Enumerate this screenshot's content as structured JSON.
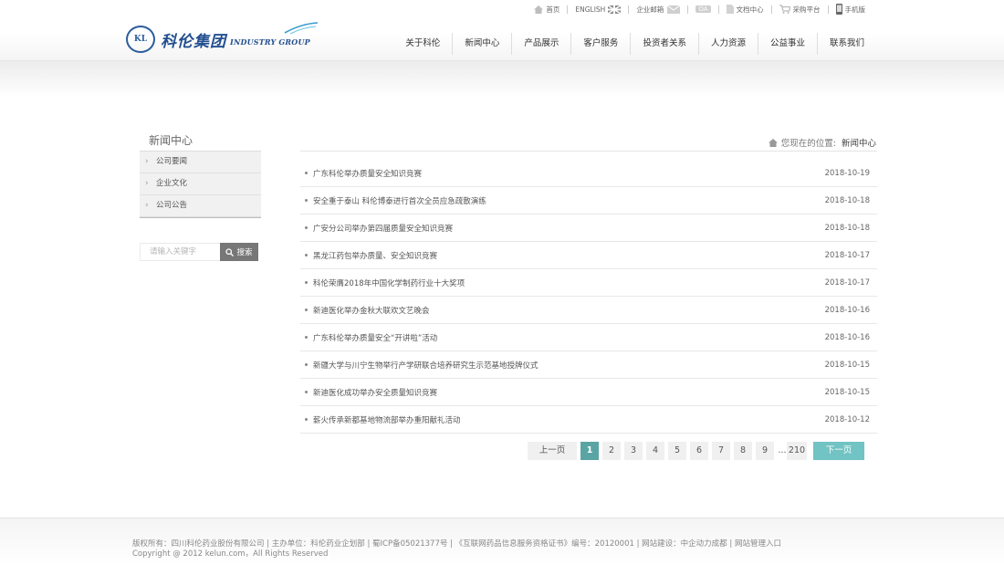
{
  "util_bar": {
    "home": "首页",
    "english": "ENGLISH",
    "mail": "企业邮箱",
    "oa": "OA",
    "docs": "文档中心",
    "purchase": "采购平台",
    "mobile": "手机版"
  },
  "logo": {
    "cn": "科伦集团",
    "en": "INDUSTRY GROUP",
    "emblem": "KL"
  },
  "nav": [
    "关于科伦",
    "新闻中心",
    "产品展示",
    "客户服务",
    "投资者关系",
    "人力资源",
    "公益事业",
    "联系我们"
  ],
  "sidebar": {
    "title": "新闻中心",
    "items": [
      "公司要闻",
      "企业文化",
      "公司公告"
    ]
  },
  "search": {
    "placeholder": "请输入关键字",
    "button": "搜索"
  },
  "breadcrumb": {
    "prefix": "您现在的位置:",
    "current": "新闻中心"
  },
  "news": [
    {
      "title": "广东科伦举办质量安全知识竞赛",
      "date": "2018-10-19"
    },
    {
      "title": "安全重于泰山 科伦博泰进行首次全员应急疏散演练",
      "date": "2018-10-18"
    },
    {
      "title": "广安分公司举办第四届质量安全知识竞赛",
      "date": "2018-10-18"
    },
    {
      "title": "黑龙江药包举办质量、安全知识竞赛",
      "date": "2018-10-17"
    },
    {
      "title": "科伦荣膺2018年中国化学制药行业十大奖项",
      "date": "2018-10-17"
    },
    {
      "title": "新迪医化举办金秋大联欢文艺晚会",
      "date": "2018-10-16"
    },
    {
      "title": "广东科伦举办质量安全“开讲啦”活动",
      "date": "2018-10-16"
    },
    {
      "title": "新疆大学与川宁生物举行产学研联合培养研究生示范基地授牌仪式",
      "date": "2018-10-15"
    },
    {
      "title": "新迪医化成功举办安全质量知识竞赛",
      "date": "2018-10-15"
    },
    {
      "title": "薪火传承新都基地物流部举办重阳献礼活动",
      "date": "2018-10-12"
    }
  ],
  "pagination": {
    "prev": "上一页",
    "pages": [
      "1",
      "2",
      "3",
      "4",
      "5",
      "6",
      "7",
      "8",
      "9"
    ],
    "current_page": "1",
    "ellipsis": "...",
    "last": "210",
    "next": "下一页"
  },
  "footer": {
    "line1": "版权所有：四川科伦药业股份有限公司 | 主办单位：科伦药业企划部 | 蜀ICP备05021377号 | 《互联网药品信息服务资格证书》编号：20120001 | 网站建设：中企动力成都 | 网站管理入口",
    "line2": "Copyright @ 2012 kelun.com，All Rights Reserved"
  },
  "colors": {
    "accent_teal": "#5aa5a4",
    "next_button": "#72c3c3",
    "brand_blue": "#234f8f"
  }
}
